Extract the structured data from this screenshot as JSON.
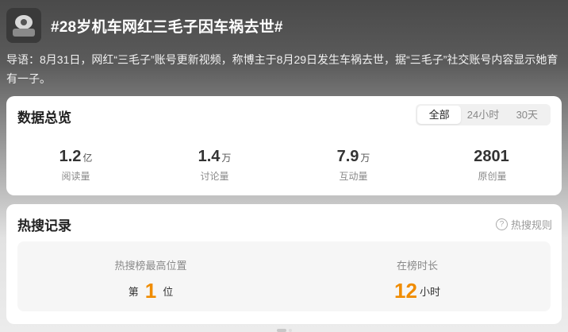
{
  "header": {
    "avatar_icon": "topic-avatar-icon",
    "title": "#28岁机车网红三毛子因车祸去世#"
  },
  "lead": "导语：8月31日，网红“三毛子”账号更新视频，称博主于8月29日发生车祸去世，据“三毛子”社交账号内容显示她育有一子。",
  "overview": {
    "title": "数据总览",
    "tabs": [
      {
        "label": "全部",
        "active": true
      },
      {
        "label": "24小时",
        "active": false
      },
      {
        "label": "30天",
        "active": false
      }
    ],
    "stats": [
      {
        "value": "1.2",
        "unit": "亿",
        "label": "阅读量"
      },
      {
        "value": "1.4",
        "unit": "万",
        "label": "讨论量"
      },
      {
        "value": "7.9",
        "unit": "万",
        "label": "互动量"
      },
      {
        "value": "2801",
        "unit": "",
        "label": "原创量"
      }
    ]
  },
  "hot": {
    "title": "热搜记录",
    "rules_link": "热搜规则",
    "rules_icon": "question-circle-icon",
    "highest_label": "热搜榜最高位置",
    "rank_prefix": "第",
    "rank_value": "1",
    "rank_suffix": "位",
    "duration_label": "在榜时长",
    "duration_value": "12",
    "duration_unit": "小时",
    "accent_color": "#f08c00"
  }
}
